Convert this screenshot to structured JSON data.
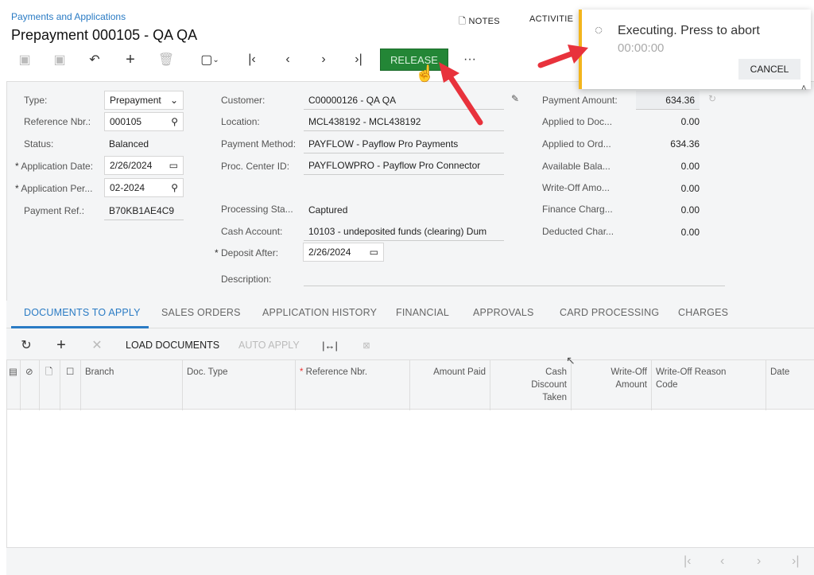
{
  "header": {
    "breadcrumb": "Payments and Applications",
    "title": "Prepayment 000105 - QA QA",
    "notes": "NOTES",
    "activities": "ACTIVITIE"
  },
  "toolbar": {
    "release": "RELEASE",
    "more": "···"
  },
  "notification": {
    "message": "Executing. Press to abort",
    "timer": "00:00:00",
    "cancel": "CANCEL"
  },
  "form": {
    "left": [
      {
        "label": "Type:",
        "value": "Prepayment",
        "kind": "select"
      },
      {
        "label": "Reference Nbr.:",
        "value": "000105",
        "kind": "lookup"
      },
      {
        "label": "Status:",
        "value": "Balanced",
        "kind": "text"
      },
      {
        "label": "Application Date:",
        "value": "2/26/2024",
        "kind": "date",
        "required": true
      },
      {
        "label": "Application Per...",
        "value": "02-2024",
        "kind": "lookup",
        "required": true
      },
      {
        "label": "Payment Ref.:",
        "value": "B70KB1AE4C9",
        "kind": "text"
      }
    ],
    "middle": {
      "customer_label": "Customer:",
      "customer": "C00000126 - QA QA",
      "location_label": "Location:",
      "location": "MCL438192 - MCL438192",
      "method_label": "Payment Method:",
      "method": "PAYFLOW - Payflow Pro Payments",
      "proc_label": "Proc. Center ID:",
      "proc": "PAYFLOWPRO - Payflow Pro Connector",
      "pstatus_label": "Processing Sta...",
      "pstatus": "Captured",
      "cash_label": "Cash Account:",
      "cash": "10103 - undeposited funds (clearing) Dum",
      "deposit_label": "Deposit After:",
      "deposit": "2/26/2024",
      "desc_label": "Description:",
      "desc": ""
    },
    "right": [
      {
        "label": "Payment Amount:",
        "value": "634.36"
      },
      {
        "label": "Applied to Doc...",
        "value": "0.00"
      },
      {
        "label": "Applied to Ord...",
        "value": "634.36"
      },
      {
        "label": "Available Bala...",
        "value": "0.00"
      },
      {
        "label": "Write-Off Amo...",
        "value": "0.00"
      },
      {
        "label": "Finance Charg...",
        "value": "0.00"
      },
      {
        "label": "Deducted Char...",
        "value": "0.00"
      }
    ]
  },
  "tabs": [
    "DOCUMENTS TO APPLY",
    "SALES ORDERS",
    "APPLICATION HISTORY",
    "FINANCIAL",
    "APPROVALS",
    "CARD PROCESSING",
    "CHARGES"
  ],
  "grid_toolbar": {
    "load": "LOAD DOCUMENTS",
    "auto": "AUTO APPLY"
  },
  "grid": {
    "columns": [
      "Branch",
      "Doc. Type",
      "Reference Nbr.",
      "Amount Paid",
      "Cash Discount Taken",
      "Write-Off Amount",
      "Write-Off Reason Code",
      "Date"
    ]
  },
  "colors": {
    "accent": "#2a7bc4",
    "release": "#238636",
    "notice": "#f3b51c",
    "arrow": "#e8323c"
  }
}
